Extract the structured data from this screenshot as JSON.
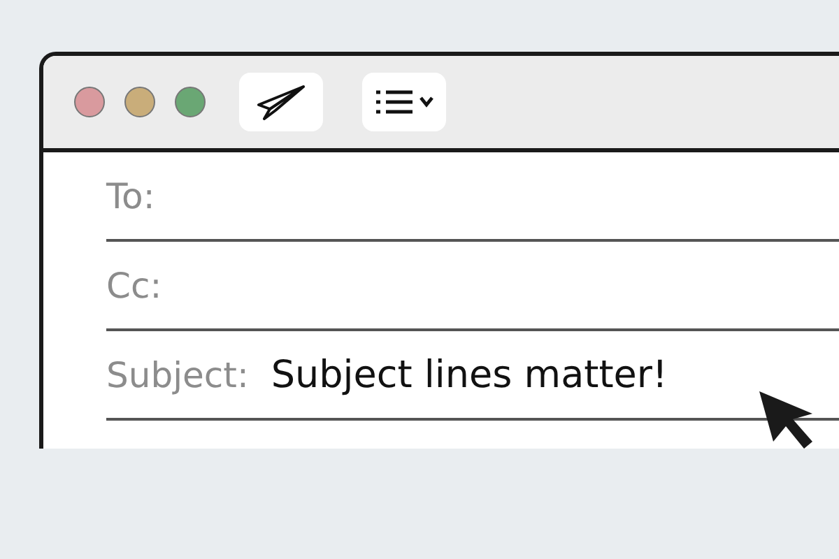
{
  "window_controls": [
    {
      "color": "#d99a9e"
    },
    {
      "color": "#c9ad7a"
    },
    {
      "color": "#6aa774"
    }
  ],
  "fields": [
    {
      "label": "To:"
    },
    {
      "label": "Cc:"
    },
    {
      "label": "Subject:",
      "value": "Subject lines matter!"
    }
  ]
}
